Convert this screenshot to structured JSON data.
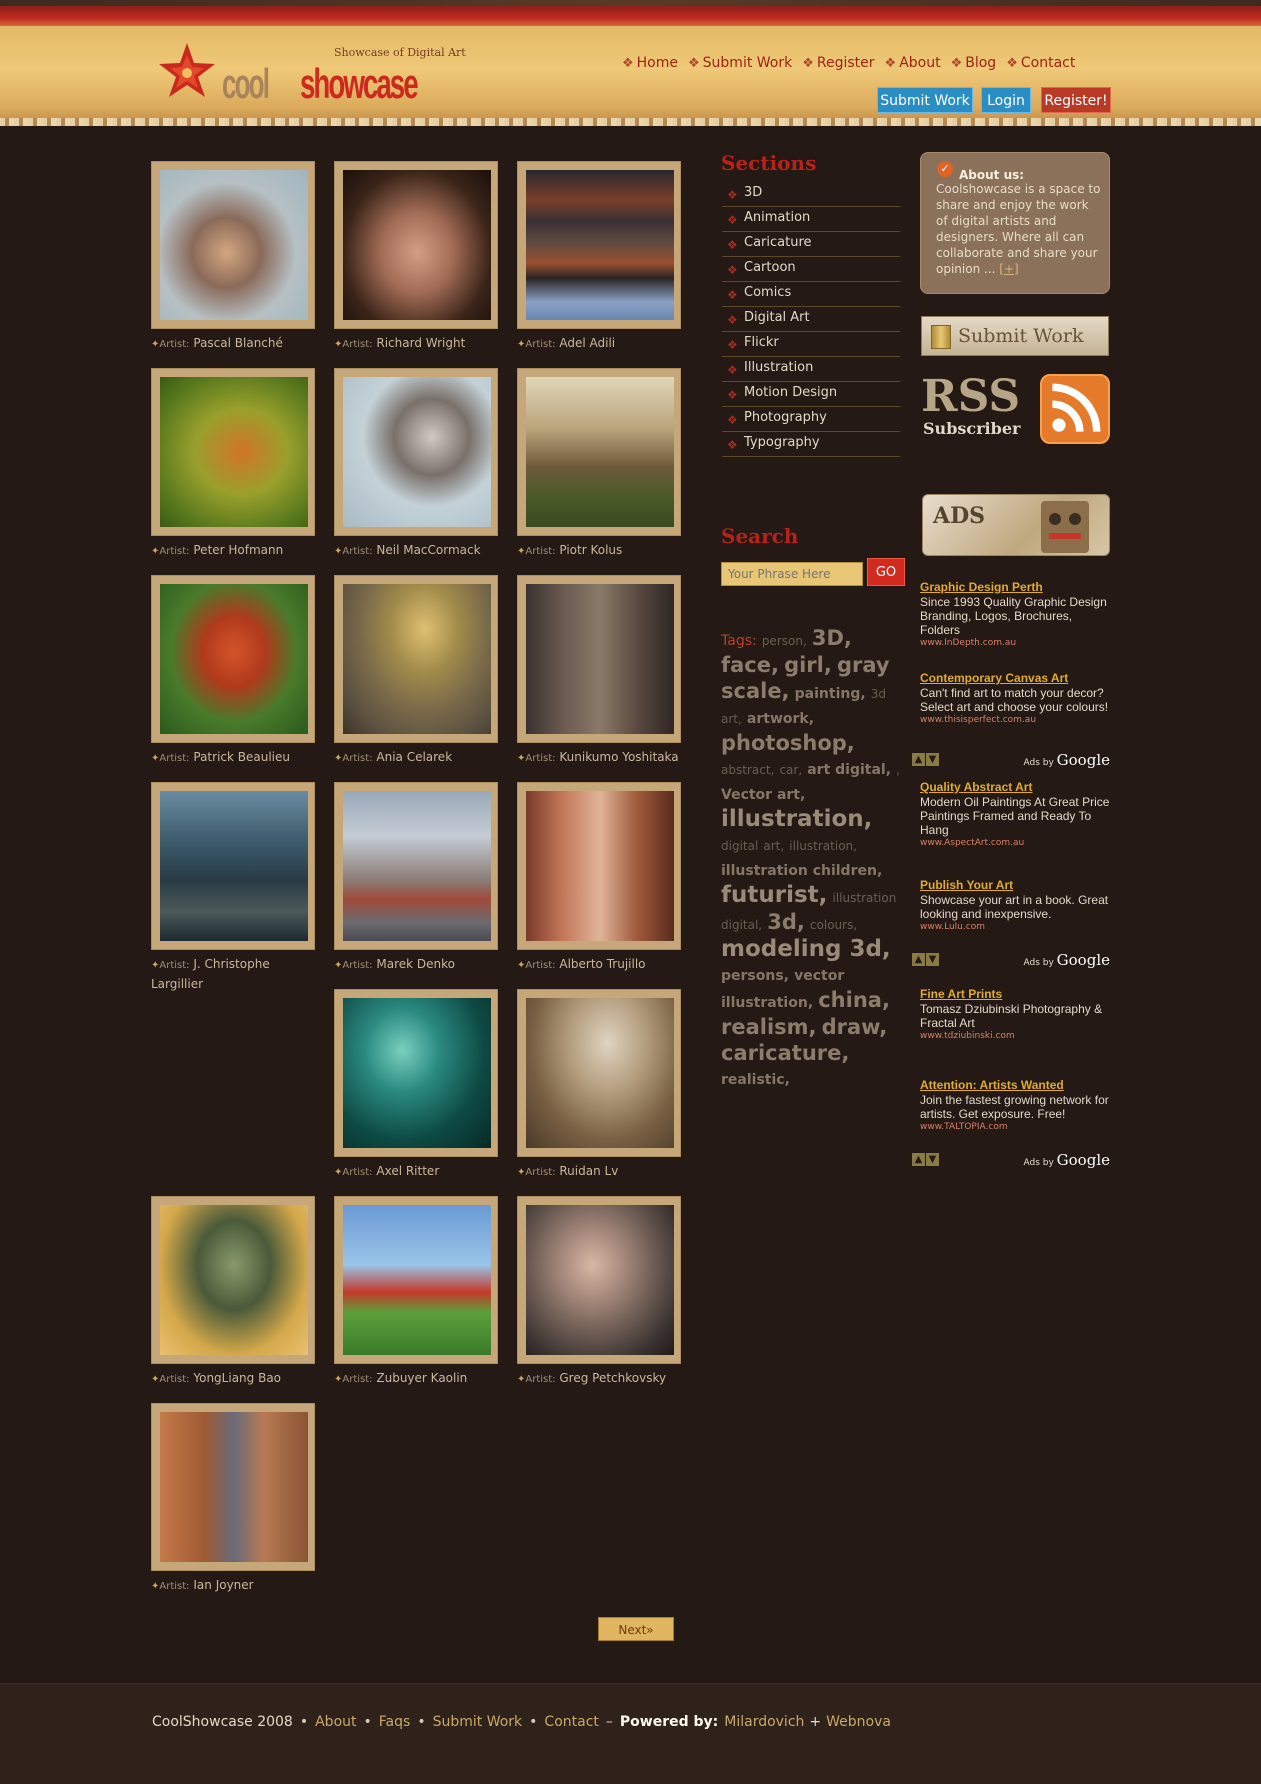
{
  "site": {
    "name_part1": "cool",
    "name_part2": "showcase",
    "tagline": "Showcase of Digital Art"
  },
  "nav": {
    "items": [
      "Home",
      "Submit Work",
      "Register",
      "About",
      "Blog",
      "Contact"
    ]
  },
  "header_buttons": {
    "submit": "Submit Work",
    "login": "Login",
    "register": "Register!"
  },
  "gallery": {
    "artist_prefix": "Artist:",
    "items": [
      {
        "artist": "Pascal Blanché"
      },
      {
        "artist": "Richard Wright"
      },
      {
        "artist": "Adel Adili"
      },
      {
        "artist": "Peter Hofmann"
      },
      {
        "artist": "Neil MacCormack"
      },
      {
        "artist": "Piotr Kolus"
      },
      {
        "artist": "Patrick Beaulieu"
      },
      {
        "artist": "Ania Celarek"
      },
      {
        "artist": "Kunikumo Yoshitaka"
      },
      {
        "artist": "J. Christophe Largillier"
      },
      {
        "artist": "Marek Denko"
      },
      {
        "artist": "Alberto Trujillo"
      },
      {
        "artist": "Axel Ritter"
      },
      {
        "artist": "Ruidan Lv"
      },
      {
        "artist": "YongLiang Bao"
      },
      {
        "artist": "Zubuyer Kaolin"
      },
      {
        "artist": "Greg Petchkovsky"
      },
      {
        "artist": "Ian Joyner"
      }
    ]
  },
  "sections": {
    "title": "Sections",
    "items": [
      "3D",
      "Animation",
      "Caricature",
      "Cartoon",
      "Comics",
      "Digital Art",
      "Flickr",
      "Illustration",
      "Motion Design",
      "Photography",
      "Typography"
    ]
  },
  "search": {
    "title": "Search",
    "placeholder": "Your Phrase Here",
    "button": "GO"
  },
  "tags": {
    "label": "Tags:",
    "items": [
      "person,",
      "3D,",
      "face,",
      "girl,",
      "gray",
      "scale,",
      "painting,",
      "3d",
      "art,",
      "artwork,",
      "photoshop,",
      "abstract,",
      "car,",
      "art digital,",
      ",",
      "Vector art,",
      "illustration,",
      "digital",
      "art,",
      "illustration,",
      "illustration children,",
      "futurist,",
      "illustration",
      "digital,",
      "3d,",
      "colours,",
      "modeling 3d,",
      "persons,",
      "vector",
      "illustration,",
      "china,",
      "realism,",
      "draw,",
      "caricature,",
      "realistic,"
    ]
  },
  "about": {
    "title": "About us:",
    "text": "Coolshowcase is a space to share and enjoy the work of digital artists and designers. Where all can collaborate and share your opinion ...",
    "more": "[+]"
  },
  "submit_banner": "Submit Work",
  "rss": {
    "word": "RSS",
    "sub": "Subscriber"
  },
  "ads_banner": "ADS",
  "ads": [
    {
      "title": "Graphic Design Perth",
      "body": "Since 1993 Quality Graphic Design Branding, Logos, Brochures, Folders",
      "url": "www.InDepth.com.au"
    },
    {
      "title": "Contemporary Canvas Art",
      "body": "Can't find art to match your decor? Select art and choose your colours!",
      "url": "www.thisisperfect.com.au"
    },
    {
      "title": "Quality Abstract Art",
      "body": "Modern Oil Paintings At Great Price Paintings Framed and Ready To Hang",
      "url": "www.AspectArt.com.au"
    },
    {
      "title": "Publish Your Art",
      "body": "Showcase your art in a book. Great looking and inexpensive.",
      "url": "www.Lulu.com"
    },
    {
      "title": "Fine Art Prints",
      "body": "Tomasz Dziubinski Photography & Fractal Art",
      "url": "www.tdziubinski.com"
    },
    {
      "title": "Attention: Artists Wanted",
      "body": "Join the fastest growing network for artists. Get exposure. Free!",
      "url": "www.TALTOPIA.com"
    }
  ],
  "ads_by": {
    "prefix": "Ads by",
    "brand": "Google"
  },
  "pagination": {
    "next": "Next»"
  },
  "footer": {
    "copyright": "CoolShowcase 2008",
    "links": [
      "About",
      "Faqs",
      "Submit Work",
      "Contact"
    ],
    "powered_label": "Powered by:",
    "powered_1": "Milardovich",
    "plus": "+",
    "powered_2": "Webnova"
  },
  "colors": {
    "background": "#241914",
    "header_gold": "#efc978",
    "accent_red": "#cc2a1d",
    "nav_red": "#9b2416",
    "link_gold": "#e0ac2a"
  }
}
